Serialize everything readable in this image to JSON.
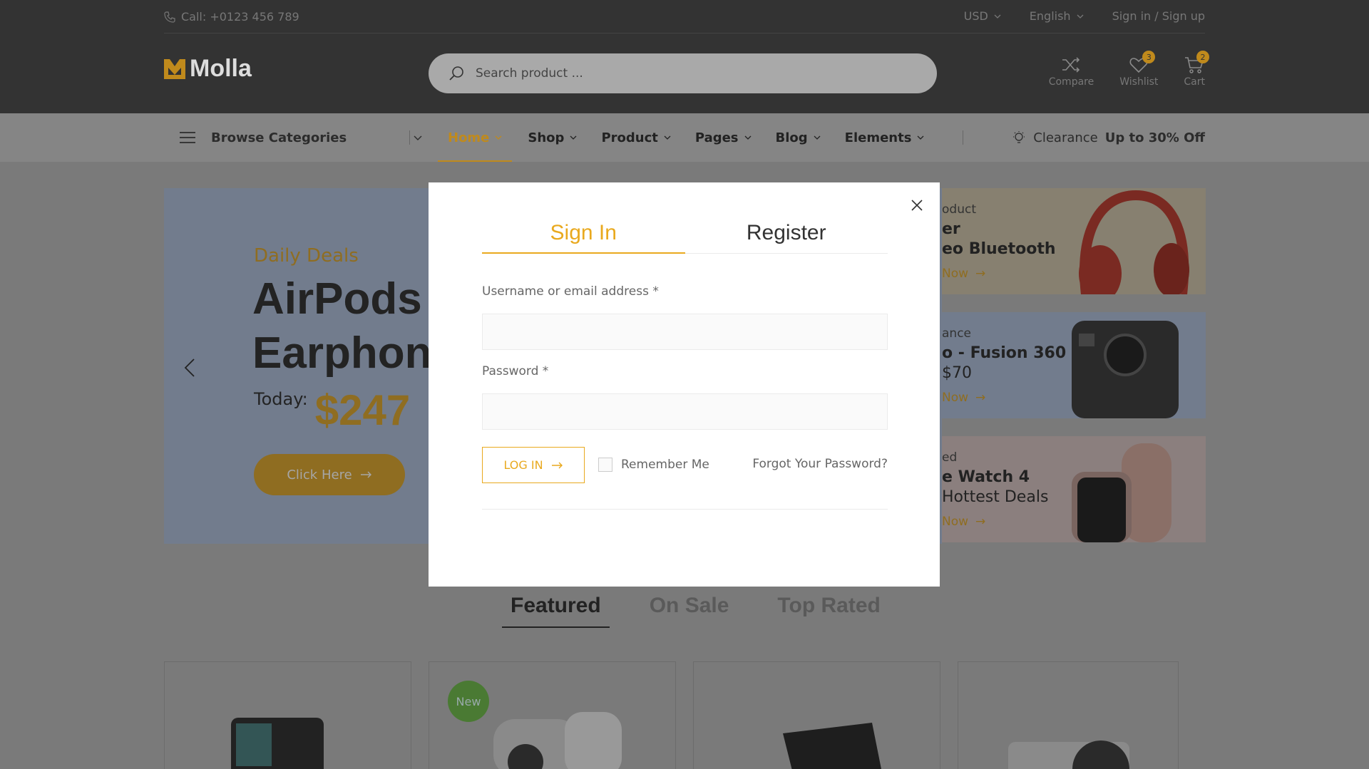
{
  "topbar": {
    "call": "Call: +0123 456 789",
    "currency": "USD",
    "language": "English",
    "signin": "Sign in / Sign up"
  },
  "header": {
    "logo": "Molla",
    "search_placeholder": "Search product ...",
    "icons": [
      {
        "label": "Compare",
        "icon": "shuffle-icon"
      },
      {
        "label": "Wishlist",
        "icon": "heart-icon",
        "count": "3"
      },
      {
        "label": "Cart",
        "icon": "cart-icon",
        "count": "2"
      }
    ]
  },
  "nav": {
    "browse": "Browse Categories",
    "items": [
      "Home",
      "Shop",
      "Product",
      "Pages",
      "Blog",
      "Elements"
    ],
    "clearance_prefix": "Clearance",
    "clearance_bold": "Up to 30% Off"
  },
  "hero": {
    "eyebrow": "Daily Deals",
    "title_line1": "AirPods",
    "title_line2": "Earphon",
    "today": "Today:",
    "price": "$247",
    "cta": "Click Here"
  },
  "side_banners": [
    {
      "cat": "oduct",
      "name1": "er",
      "name2": "eo Bluetooth",
      "shop": "Now"
    },
    {
      "cat": "ance",
      "name1": "o - Fusion 360",
      "name2": "$70",
      "shop": "Now"
    },
    {
      "cat": "ed",
      "name1": "e Watch 4",
      "name2": "Hottest Deals",
      "shop": "Now"
    }
  ],
  "product_tabs": [
    "Featured",
    "On Sale",
    "Top Rated"
  ],
  "cards": {
    "new_badge": "New"
  },
  "modal": {
    "tab_signin": "Sign In",
    "tab_register": "Register",
    "username_label": "Username or email address *",
    "username_value": "",
    "password_label": "Password *",
    "password_value": "",
    "login_button": "LOG IN",
    "remember": "Remember Me",
    "forgot": "Forgot Your Password?"
  },
  "colors": {
    "accent": "#e9a91e",
    "dark": "#333333"
  }
}
